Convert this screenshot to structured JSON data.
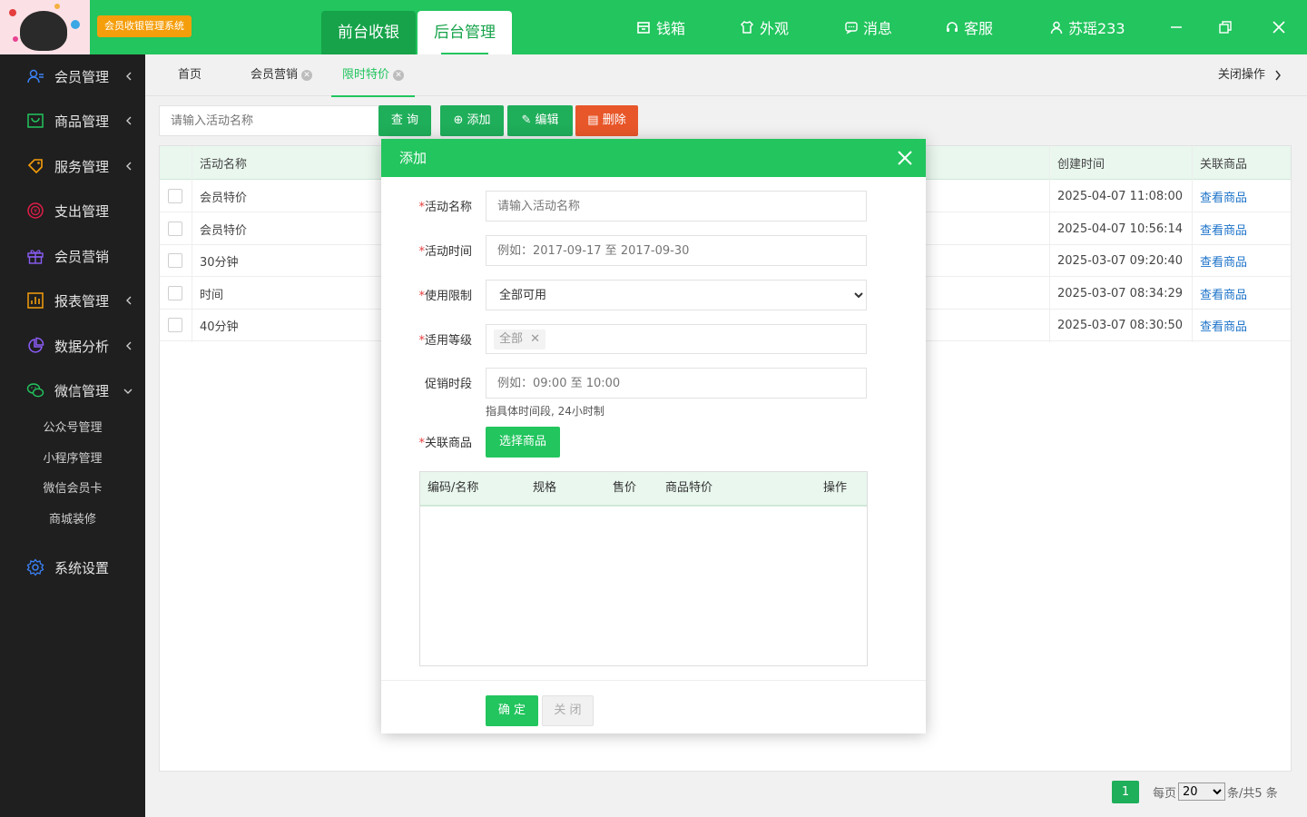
{
  "header": {
    "system_badge": "会员收银管理系统",
    "tab_front": "前台收银",
    "tab_back": "后台管理",
    "nav": [
      {
        "label": "钱箱",
        "icon": "cash-box-icon"
      },
      {
        "label": "外观",
        "icon": "shirt-icon"
      },
      {
        "label": "消息",
        "icon": "message-icon"
      },
      {
        "label": "客服",
        "icon": "headset-icon"
      },
      {
        "label": "苏瑶233",
        "icon": "user-icon"
      }
    ]
  },
  "sidebar": {
    "items": [
      {
        "label": "会员管理",
        "icon": "members-icon"
      },
      {
        "label": "商品管理",
        "icon": "goods-icon"
      },
      {
        "label": "服务管理",
        "icon": "service-icon"
      },
      {
        "label": "支出管理",
        "icon": "expense-icon"
      },
      {
        "label": "会员营销",
        "icon": "gift-icon"
      },
      {
        "label": "报表管理",
        "icon": "report-icon"
      },
      {
        "label": "数据分析",
        "icon": "analytics-icon"
      },
      {
        "label": "微信管理",
        "icon": "wechat-icon"
      },
      {
        "label": "系统设置",
        "icon": "settings-icon"
      }
    ],
    "wechat_sub": [
      "公众号管理",
      "小程序管理",
      "微信会员卡",
      "商城装修"
    ]
  },
  "content_tabs": {
    "items": [
      "首页",
      "会员营销",
      "限时特价"
    ],
    "close_ops": "关闭操作"
  },
  "toolbar": {
    "search_placeholder": "请输入活动名称",
    "query": "查 询",
    "add": "添加",
    "edit": "编辑",
    "delete": "删除"
  },
  "table": {
    "headers": {
      "name": "活动名称",
      "created": "创建时间",
      "goods": "关联商品"
    },
    "rows": [
      {
        "name": "会员特价",
        "created": "2025-04-07 11:08:00",
        "goods": "查看商品"
      },
      {
        "name": "会员特价",
        "created": "2025-04-07 10:56:14",
        "goods": "查看商品"
      },
      {
        "name": "30分钟",
        "created": "2025-03-07 09:20:40",
        "goods": "查看商品"
      },
      {
        "name": "时间",
        "created": "2025-03-07 08:34:29",
        "goods": "查看商品"
      },
      {
        "name": "40分钟",
        "created": "2025-03-07 08:30:50",
        "goods": "查看商品"
      }
    ]
  },
  "pager": {
    "current": "1",
    "per_page_prefix": "每页",
    "per_page": "20",
    "suffix": "条/共5 条"
  },
  "modal": {
    "title": "添加",
    "fields": {
      "name_label": "活动名称",
      "name_placeholder": "请输入活动名称",
      "time_label": "活动时间",
      "time_placeholder": "例如：2017-09-17 至 2017-09-30",
      "limit_label": "使用限制",
      "limit_value": "全部可用",
      "level_label": "适用等级",
      "level_tag": "全部",
      "period_label": "促销时段",
      "period_placeholder": "例如：09:00 至 10:00",
      "period_hint": "指具体时间段, 24小时制",
      "goods_label": "关联商品",
      "choose_goods": "选择商品"
    },
    "subtable_headers": [
      "编码/名称",
      "规格",
      "售价",
      "商品特价",
      "操作"
    ],
    "ok": "确 定",
    "cancel": "关 闭"
  }
}
